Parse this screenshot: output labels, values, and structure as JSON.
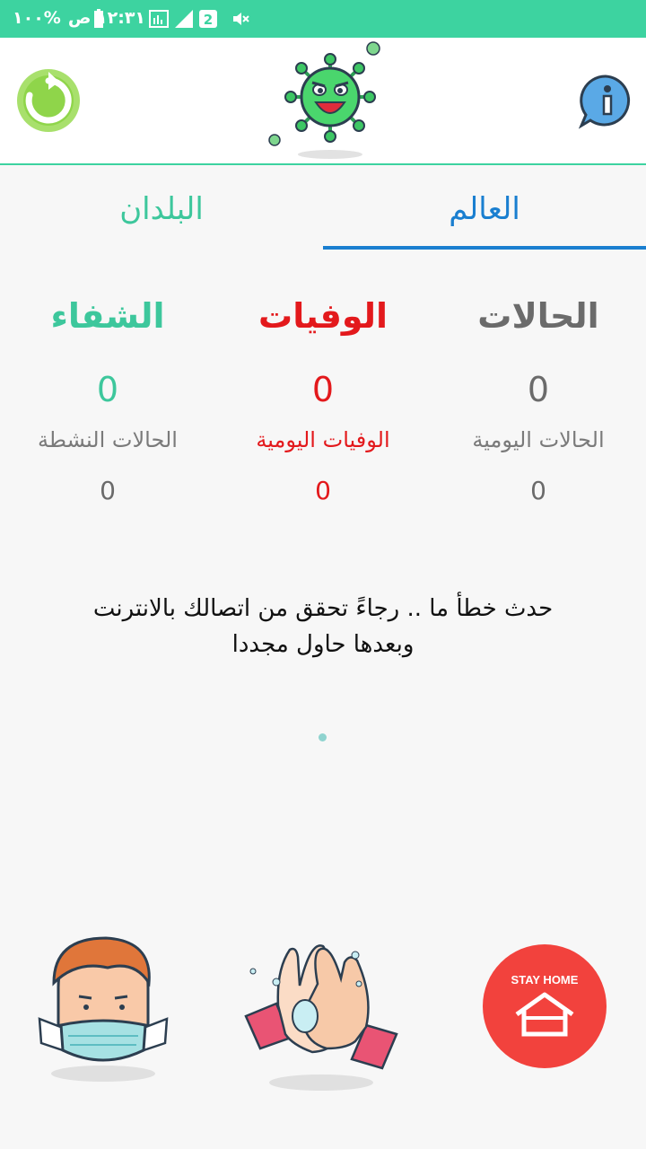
{
  "status_bar": {
    "time": "١٢:٣١ ص",
    "battery": "%١٠٠",
    "sim_badge": "2"
  },
  "header": {
    "refresh_icon": "refresh-icon",
    "info_icon": "info-icon",
    "logo_icon": "virus-mascot-icon"
  },
  "tabs": {
    "world": "العالم",
    "countries": "البلدان",
    "active": "world"
  },
  "stats": {
    "cases_label": "الحالات",
    "deaths_label": "الوفيات",
    "recovered_label": "الشفاء",
    "cases_value": "0",
    "deaths_value": "0",
    "recovered_value": "0",
    "daily_cases_label": "الحالات اليومية",
    "daily_deaths_label": "الوفيات اليومية",
    "active_cases_label": "الحالات النشطة",
    "daily_cases_value": "0",
    "daily_deaths_value": "0",
    "active_cases_value": "0"
  },
  "message": {
    "line1": "حدث خطأ ما .. رجاءً تحقق من اتصالك بالانترنت",
    "line2": "وبعدها حاول مجددا"
  },
  "bottom": {
    "stay_home_label": "STAY HOME"
  },
  "colors": {
    "accent_green": "#3dd3a0",
    "tab_blue": "#1a7fd0",
    "deaths_red": "#e3191c",
    "stay_home_red": "#f2423d"
  }
}
